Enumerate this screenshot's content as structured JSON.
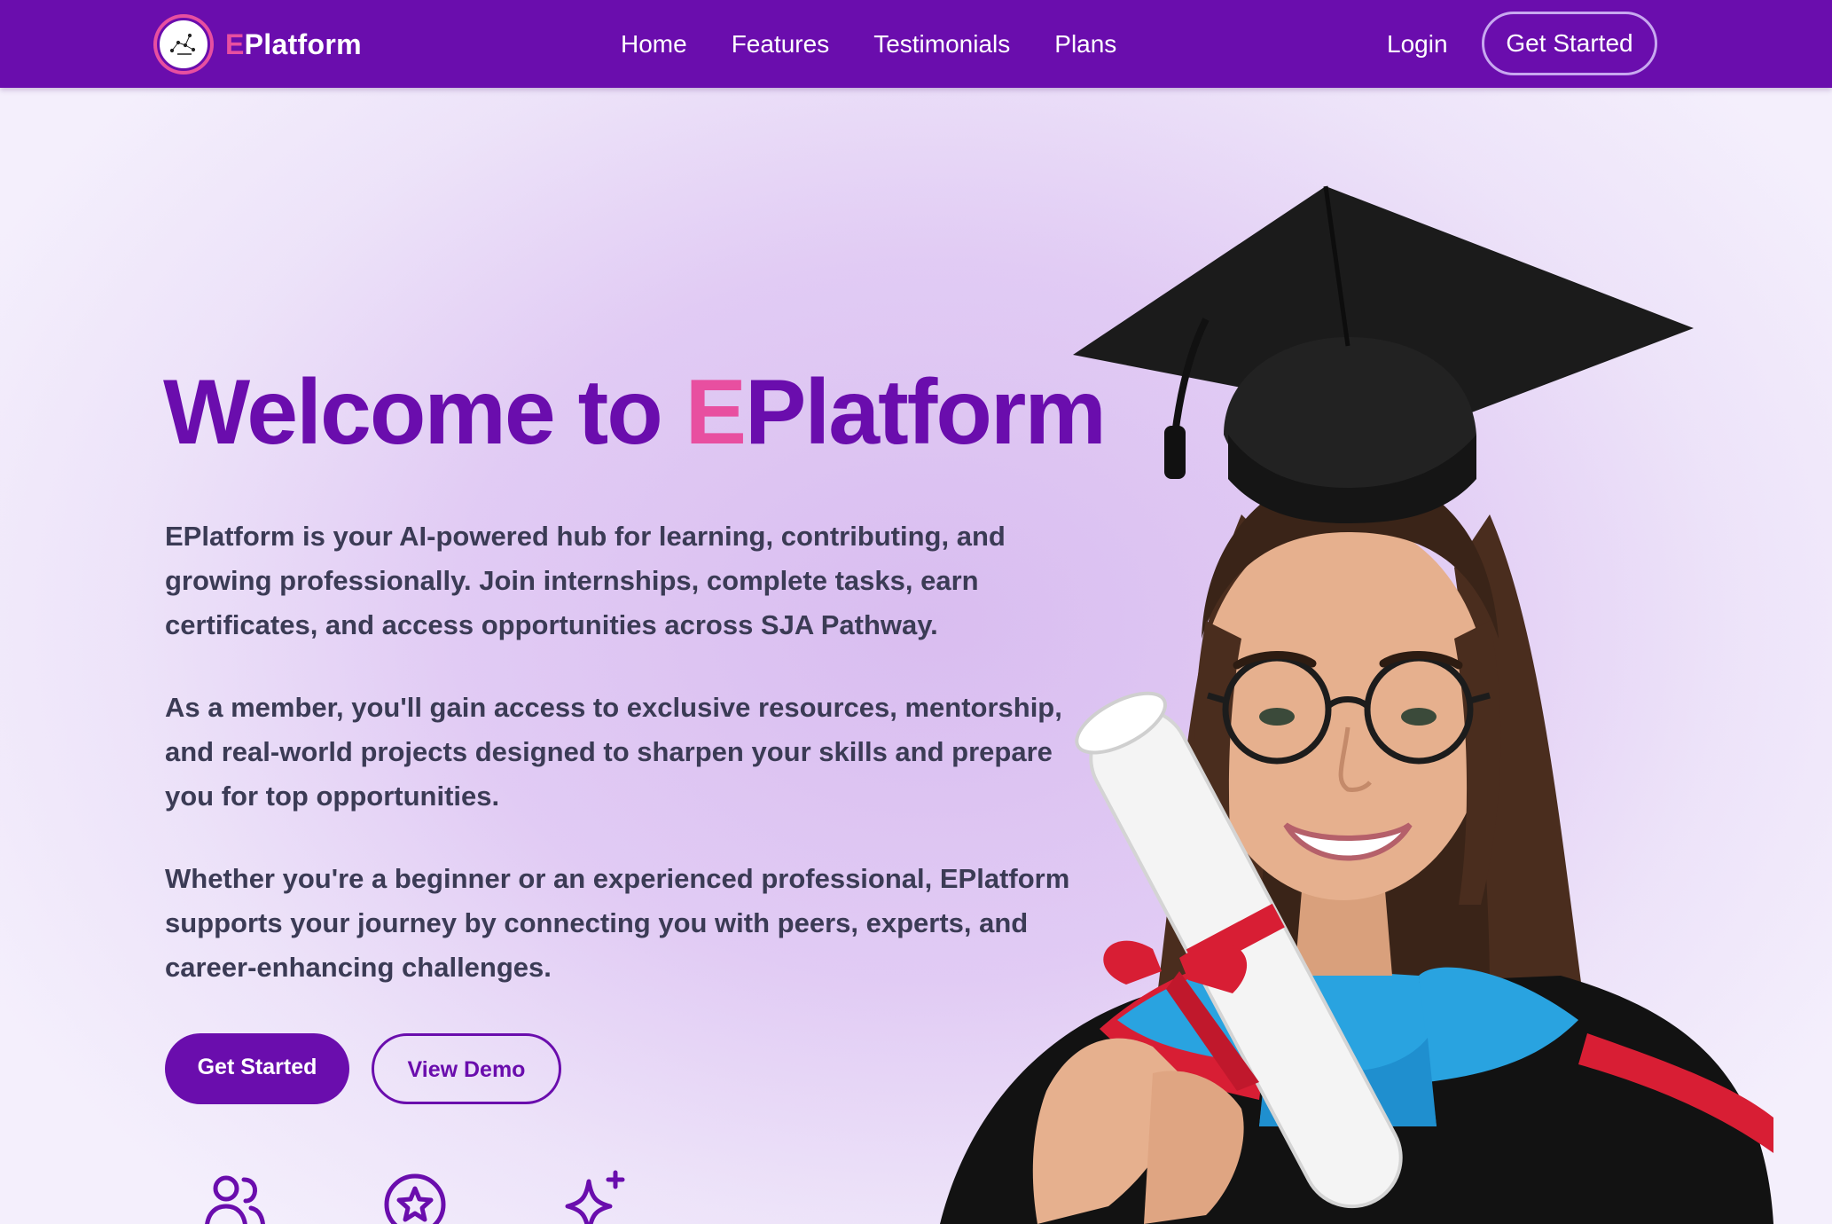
{
  "brand": {
    "first_letter": "E",
    "rest": "Platform"
  },
  "nav": {
    "links": [
      "Home",
      "Features",
      "Testimonials",
      "Plans"
    ],
    "login": "Login",
    "cta": "Get Started"
  },
  "hero": {
    "title_prefix": "Welcome to ",
    "title_accent": "E",
    "title_rest": "Platform",
    "paragraphs": [
      "EPlatform is your AI-powered hub for learning, contributing, and growing professionally. Join internships, complete tasks, earn certificates, and access opportunities across SJA Pathway.",
      "As a member, you'll gain access to exclusive resources, mentorship, and real-world projects designed to sharpen your skills and prepare you for top opportunities.",
      "Whether you're a beginner or an experienced professional, EPlatform supports your journey by connecting you with peers, experts, and career-enhancing challenges."
    ],
    "primary_button": "Get Started",
    "secondary_button": "View Demo"
  },
  "feature_icons": [
    "users-icon",
    "star-badge-icon",
    "sparkles-icon"
  ],
  "colors": {
    "primary": "#6a0dad",
    "accent": "#e84fa0",
    "text": "#3b3b55",
    "background": "#e1cbf4"
  }
}
